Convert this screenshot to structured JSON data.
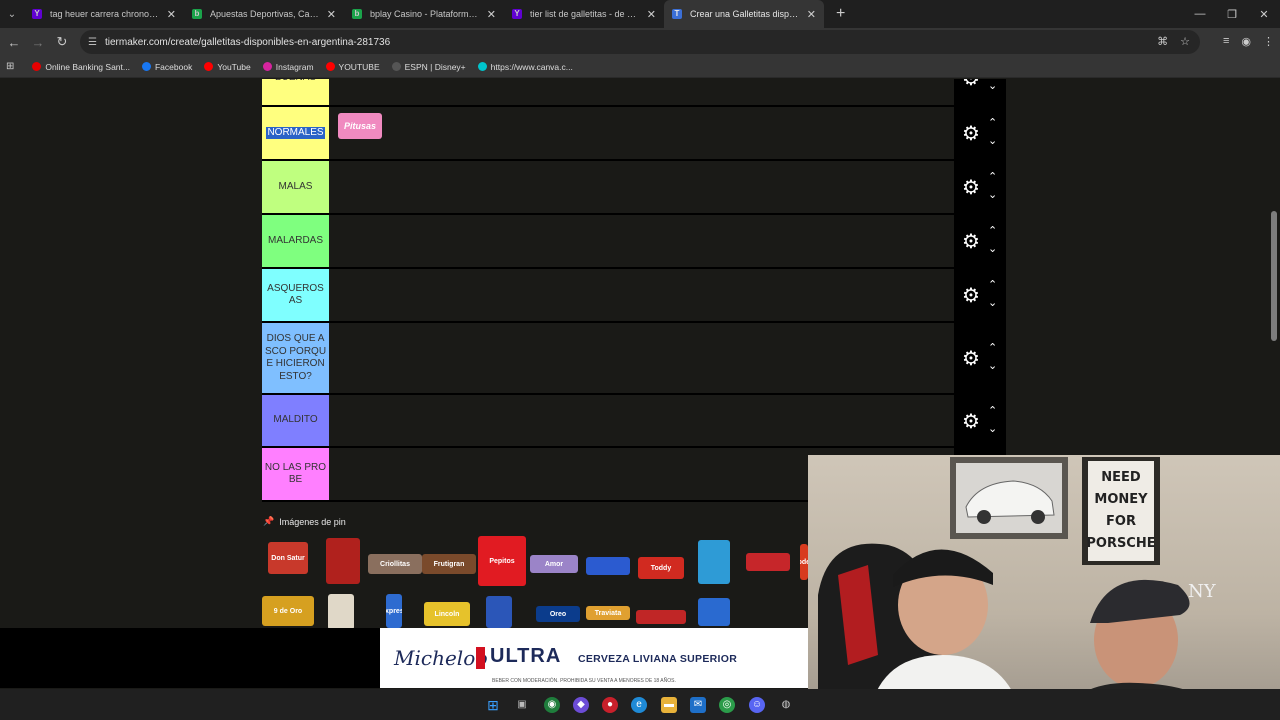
{
  "tabs": [
    {
      "title": "tag heuer carrera chronograph",
      "icon": "yahoo-icon",
      "color": "#6001d2"
    },
    {
      "title": "Apuestas Deportivas, Casino O",
      "icon": "bplay-icon",
      "color": "#1aa34a"
    },
    {
      "title": "bplay Casino - Plataforma de C",
      "icon": "bplay-icon",
      "color": "#1aa34a"
    },
    {
      "title": "tier list de galletitas - de búsq",
      "icon": "yahoo-icon",
      "color": "#6001d2"
    },
    {
      "title": "Crear una Galletitas disponible",
      "icon": "tiermaker-icon",
      "color": "#3b6fd6",
      "active": true
    }
  ],
  "address": "tiermaker.com/create/galletitas-disponibles-en-argentina-281736",
  "bookmarks": [
    {
      "label": "Online Banking Sant...",
      "icon": "santander-icon",
      "color": "#e60000"
    },
    {
      "label": "Facebook",
      "icon": "facebook-icon",
      "color": "#1877f2"
    },
    {
      "label": "YouTube",
      "icon": "youtube-icon",
      "color": "#ff0000"
    },
    {
      "label": "Instagram",
      "icon": "instagram-icon",
      "color": "#d6249f"
    },
    {
      "label": "YOUTUBE",
      "icon": "youtube-icon",
      "color": "#ff0000"
    },
    {
      "label": "ESPN | Disney+",
      "icon": "espn-icon",
      "color": "#555555"
    },
    {
      "label": "https://www.canva.c...",
      "icon": "canva-icon",
      "color": "#00c4cc"
    }
  ],
  "tiers": [
    {
      "label": "BUENAS",
      "color": "#ffff7f"
    },
    {
      "label": "NORMALES",
      "color": "#ffff7f",
      "selected": true
    },
    {
      "label": "MALAS",
      "color": "#bfff7f"
    },
    {
      "label": "MALARDAS",
      "color": "#7fff7f"
    },
    {
      "label": "ASQUEROSAS",
      "color": "#7fffff"
    },
    {
      "label": "DIOS QUE ASCO PORQUE HICIERON ESTO?",
      "color": "#7fbfff"
    },
    {
      "label": "MALDITO",
      "color": "#7f7fff"
    },
    {
      "label": "NO LAS PROBE",
      "color": "#ff7fff"
    }
  ],
  "placed_items": [
    {
      "tier": "BUENAS",
      "text": "",
      "color": "#3c6ed6"
    },
    {
      "tier": "NORMALES",
      "text": "Pitusas",
      "color": "#f08ac0"
    }
  ],
  "pin_section": {
    "title": "Imágenes de pin",
    "icon": "pin-icon"
  },
  "cookies": [
    {
      "text": "Don Satur",
      "color": "#c8392b"
    },
    {
      "text": "",
      "color": "#b0211d"
    },
    {
      "text": "Criollitas",
      "color": "#8a6f5e"
    },
    {
      "text": "Frutigran",
      "color": "#7a4a2b"
    },
    {
      "text": "Pepitos",
      "color": "#e11b22"
    },
    {
      "text": "Amor",
      "color": "#9b84c8"
    },
    {
      "text": "",
      "color": "#2b5bd0"
    },
    {
      "text": "Toddy",
      "color": "#d12a20"
    },
    {
      "text": "",
      "color": "#2e9bd6"
    },
    {
      "text": "",
      "color": "#c6262a"
    },
    {
      "text": "Rhodesia",
      "color": "#d83b1e"
    },
    {
      "text": "9 de Oro",
      "color": "#d6a020"
    },
    {
      "text": "",
      "color": "#e0d8c8"
    },
    {
      "text": "Express",
      "color": "#2e6bd0"
    },
    {
      "text": "Lincoln",
      "color": "#e6c22b"
    },
    {
      "text": "",
      "color": "#2b56b8"
    },
    {
      "text": "Oreo",
      "color": "#0b3c8c"
    },
    {
      "text": "Traviata",
      "color": "#e0a030"
    },
    {
      "text": "",
      "color": "#c02626"
    },
    {
      "text": "",
      "color": "#2a6ad0"
    }
  ],
  "ad": {
    "brand": "Michelob",
    "product": "ULTRA",
    "tagline": "CERVEZA LIVIANA SUPERIOR",
    "legal": "BEBER CON MODERACIÓN. PROHIBIDA SU VENTA A MENORES DE 18 AÑOS."
  },
  "webcam": {
    "sign_text": "NEED MONEY FOR PORSCHE"
  }
}
